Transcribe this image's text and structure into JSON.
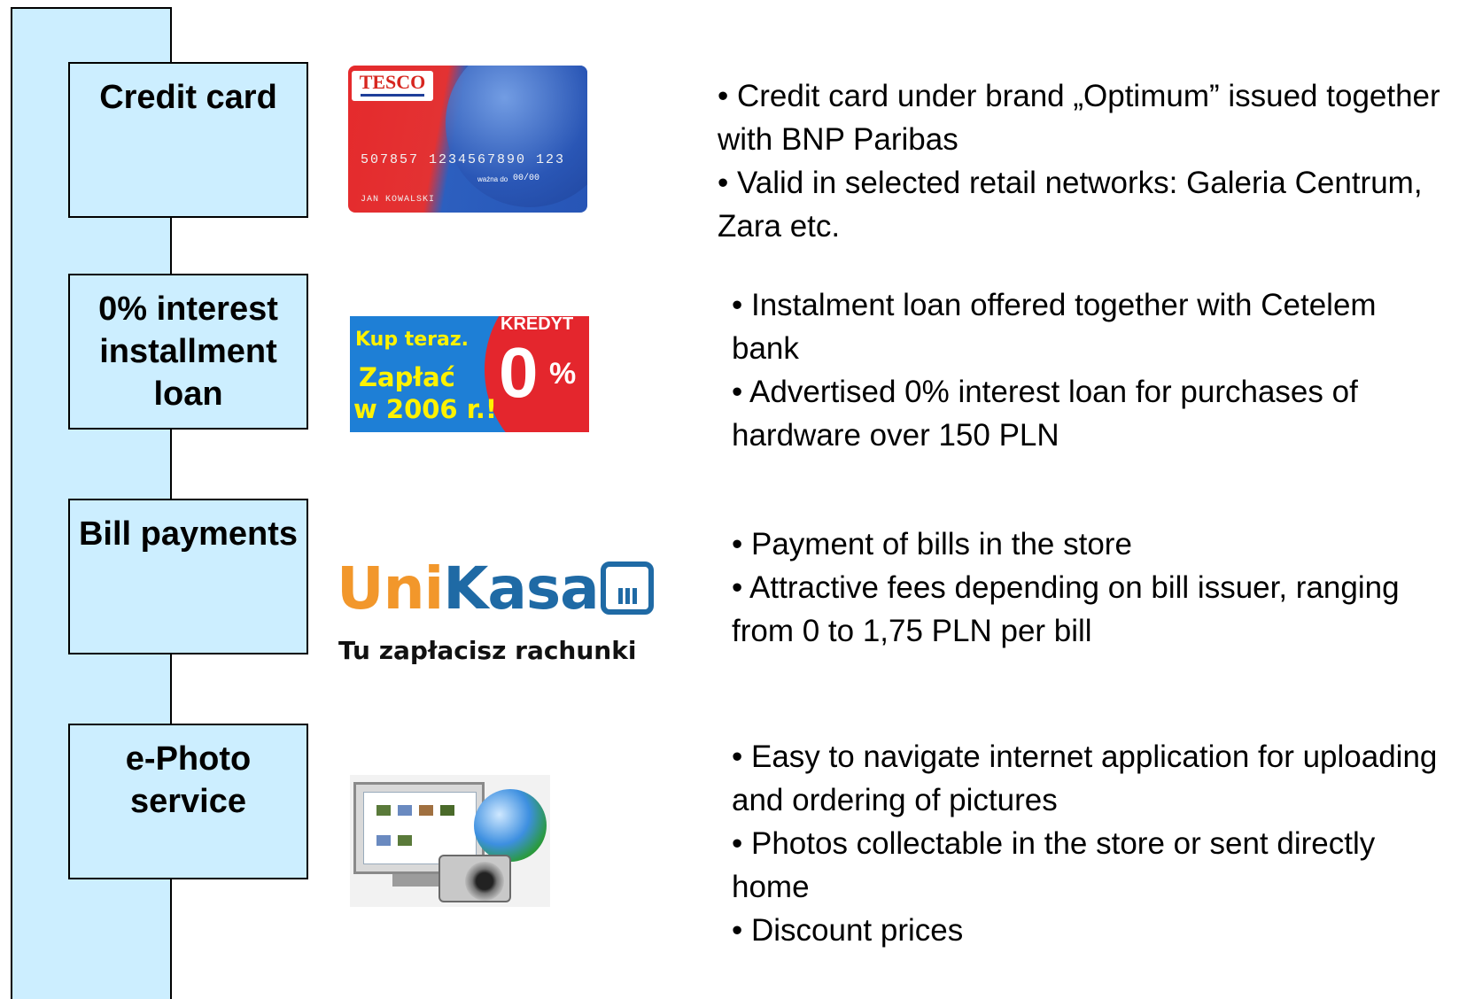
{
  "rows": [
    {
      "label": "Credit card",
      "bullets": [
        "• Credit card under brand „Optimum” issued together with BNP Paribas",
        "• Valid in selected retail networks: Galeria Centrum, Zara etc."
      ]
    },
    {
      "label": "0% interest installment loan",
      "bullets": [
        "• Instalment loan offered together with Cetelem bank",
        "• Advertised 0% interest loan for purchases of hardware over 150 PLN"
      ]
    },
    {
      "label": "Bill payments",
      "bullets": [
        "• Payment of bills in the store",
        "• Attractive fees depending on bill issuer, ranging from 0 to 1,75 PLN per bill"
      ]
    },
    {
      "label": "e-Photo service",
      "bullets": [
        "• Easy to navigate internet application for uploading and ordering of pictures",
        "• Photos collectable in the store or sent directly home",
        "• Discount prices"
      ]
    }
  ],
  "images": {
    "card": {
      "brand": "TESCO",
      "number": "507857 1234567890 123",
      "valid_label": "ważna do",
      "expiry": "00/00",
      "holder": "JAN KOWALSKI"
    },
    "kredyt": {
      "line1": "Kup teraz.",
      "line2": "Zapłać",
      "line3": "w 2006 r.!",
      "badge": "KREDYT",
      "value": "0",
      "percent": "%"
    },
    "unikasa": {
      "logo_a": "Uni",
      "logo_b": "Kasa",
      "tagline": "Tu zapłacisz rachunki"
    }
  },
  "colors": {
    "box_fill": "#cceeff",
    "border": "#000000"
  }
}
